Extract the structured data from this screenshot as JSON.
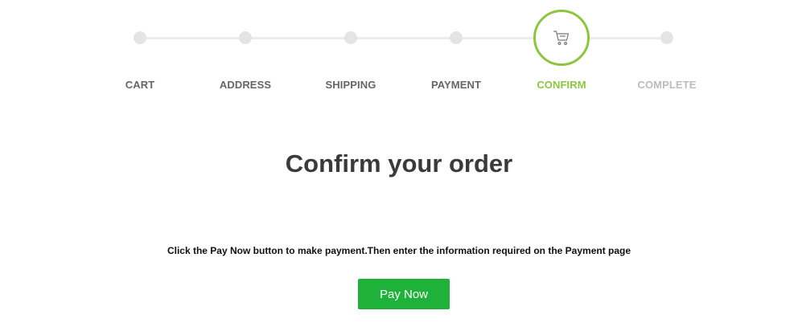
{
  "checkout": {
    "steps": [
      {
        "label": "CART",
        "state": "done"
      },
      {
        "label": "ADDRESS",
        "state": "done"
      },
      {
        "label": "SHIPPING",
        "state": "done"
      },
      {
        "label": "PAYMENT",
        "state": "done"
      },
      {
        "label": "CONFIRM",
        "state": "active",
        "icon": "cart-icon"
      },
      {
        "label": "COMPLETE",
        "state": "pending"
      }
    ]
  },
  "main": {
    "title": "Confirm your order",
    "instructions": "Click the Pay Now button to make payment.Then enter the information required on the Payment page",
    "pay_button_label": "Pay Now"
  },
  "colors": {
    "accent": "#8cc63f",
    "button": "#1fb23a",
    "text_dark": "#3a3a3a",
    "step_done_label": "#666666",
    "step_pending_label": "#bcbcbc"
  }
}
